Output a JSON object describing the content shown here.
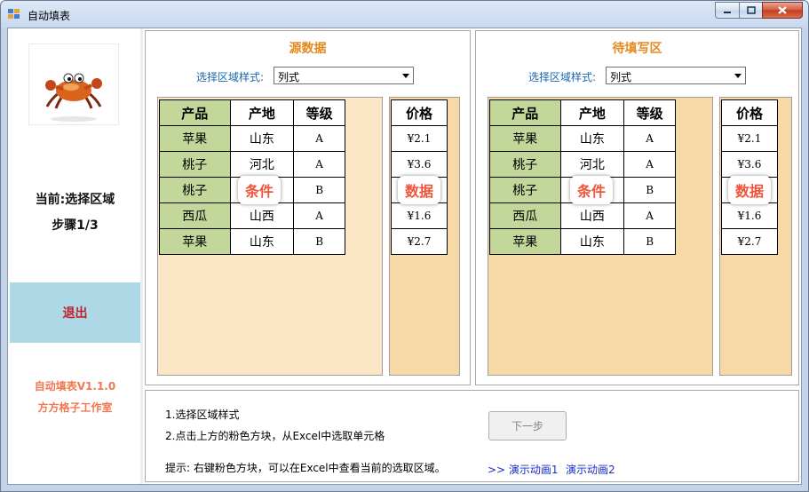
{
  "window": {
    "title": "自动填表"
  },
  "sidebar": {
    "current": "当前:选择区域",
    "step": "步骤1/3",
    "exit": "退出",
    "version": "自动填表V1.1.0",
    "studio": "方方格子工作室"
  },
  "source": {
    "title": "源数据",
    "select_label": "选择区域样式:",
    "select_value": "列式",
    "table": {
      "headers": [
        "产品",
        "产地",
        "等级"
      ],
      "rows": [
        [
          "苹果",
          "山东",
          "A"
        ],
        [
          "桃子",
          "河北",
          "A"
        ],
        [
          "桃子",
          "",
          "B"
        ],
        [
          "西瓜",
          "山西",
          "A"
        ],
        [
          "苹果",
          "山东",
          "B"
        ]
      ]
    },
    "price": {
      "header": "价格",
      "values": [
        "¥2.1",
        "¥3.6",
        "",
        "¥1.6",
        "¥2.7"
      ]
    },
    "cond_tag": "条件",
    "data_tag": "数据"
  },
  "target": {
    "title": "待填写区",
    "select_label": "选择区域样式:",
    "select_value": "列式",
    "table": {
      "headers": [
        "产品",
        "产地",
        "等级"
      ],
      "rows": [
        [
          "苹果",
          "山东",
          "A"
        ],
        [
          "桃子",
          "河北",
          "A"
        ],
        [
          "桃子",
          "",
          "B"
        ],
        [
          "西瓜",
          "山西",
          "A"
        ],
        [
          "苹果",
          "山东",
          "B"
        ]
      ]
    },
    "price": {
      "header": "价格",
      "values": [
        "¥2.1",
        "¥3.6",
        "",
        "¥1.6",
        "¥2.7"
      ]
    },
    "cond_tag": "条件",
    "data_tag": "数据"
  },
  "instructions": {
    "step1": "1.选择区域样式",
    "step2": "2.点击上方的粉色方块，从Excel中选取单元格",
    "tip": "提示:  右键粉色方块，可以在Excel中查看当前的选取区域。",
    "next": "下一步",
    "demo1": ">> 演示动画1",
    "demo2": "演示动画2"
  },
  "colors": {
    "product_col": "#c4d79b",
    "area_bg": "#fbe7c6",
    "price_area_bg": "#f6d9a7",
    "exit_bg": "#add8e6",
    "title_orange": "#e48a1c",
    "tag_red": "#f0553a"
  }
}
